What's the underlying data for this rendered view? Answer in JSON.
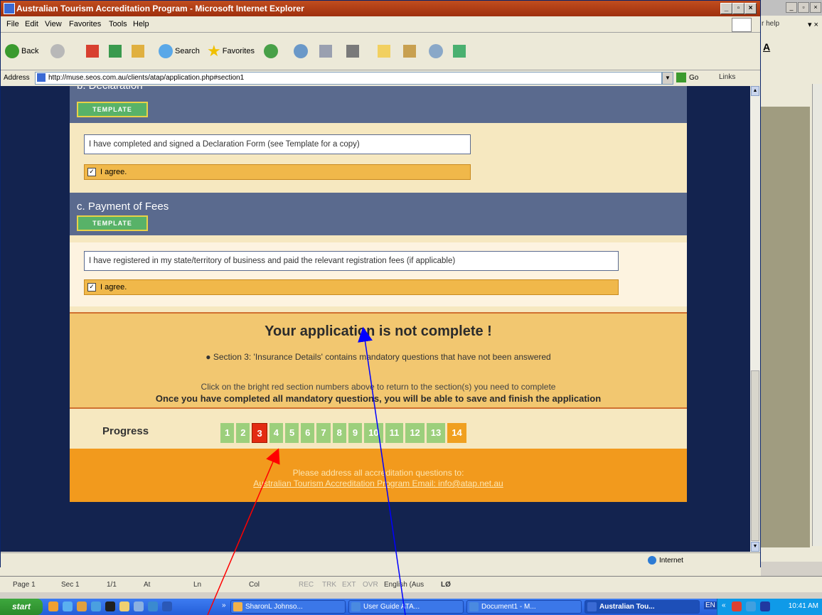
{
  "word_window": {
    "help_text": "r help",
    "close_glyph": "▾ ×",
    "font_color_label": "A",
    "title_buttons": [
      "_",
      "▫",
      "×"
    ]
  },
  "ie_window": {
    "title": "Australian Tourism Accreditation Program - Microsoft Internet Explorer",
    "title_buttons": [
      "_",
      "▫",
      "×"
    ],
    "menu": [
      "File",
      "Edit",
      "View",
      "Favorites",
      "Tools",
      "Help"
    ],
    "toolbar": {
      "back_label": "Back",
      "search_label": "Search",
      "favorites_label": "Favorites"
    },
    "address": {
      "label": "Address",
      "url": "http://muse.seos.com.au/clients/atap/application.php#section1",
      "go_label": "Go",
      "links_label": "Links"
    },
    "status": {
      "zone_label": "Internet"
    }
  },
  "page": {
    "section_b": {
      "title": "b. Declaration",
      "template_label": "TEMPLATE",
      "question": "I have completed and signed a Declaration Form (see Template for a copy)",
      "agree_label": "I agree.",
      "checked": true
    },
    "section_c": {
      "title": "c. Payment of Fees",
      "template_label": "TEMPLATE",
      "question": "I have registered in my state/territory of business and paid the relevant registration fees (if applicable)",
      "agree_label": "I agree.",
      "checked": true
    },
    "incomplete": {
      "heading": "Your application is not complete !",
      "bullet": "Section 3: 'Insurance Details' contains mandatory questions that have not been answered",
      "click_line": "Click on the bright red section numbers above to return to the section(s) you need to complete",
      "once_line": "Once you have completed all mandatory questions, you will be able to save and finish the application"
    },
    "progress": {
      "label": "Progress",
      "steps": [
        "1",
        "2",
        "3",
        "4",
        "5",
        "6",
        "7",
        "8",
        "9",
        "10",
        "11",
        "12",
        "13",
        "14"
      ],
      "current": "3",
      "last": "14",
      "colors": {
        "done": "#9ccf7c",
        "incomplete": "#e32b12",
        "final": "#f0a020"
      }
    },
    "footer": {
      "line1": "Please address all accreditation questions to:",
      "line2": "Australian Tourism Accreditation Program  Email: info@atap.net.au"
    }
  },
  "word_status": {
    "page": "Page 1",
    "sec": "Sec 1",
    "pos": "1/1",
    "at": "At",
    "ln": "Ln",
    "col": "Col",
    "rec": "REC",
    "trk": "TRK",
    "ext": "EXT",
    "ovr": "OVR",
    "lang": "English (Aus",
    "icon_text": "LØ"
  },
  "taskbar": {
    "start_label": "start",
    "tasks": [
      {
        "label": "SharonL Johnso..."
      },
      {
        "label": "User Guide ATA..."
      },
      {
        "label": "Document1 - M..."
      },
      {
        "label": "Australian Tou..."
      }
    ],
    "lang": "EN",
    "clock": "10:41 AM"
  },
  "annotations": {
    "red_arrow_color": "#ff0000",
    "blue_arrow_color": "#0000ff"
  }
}
